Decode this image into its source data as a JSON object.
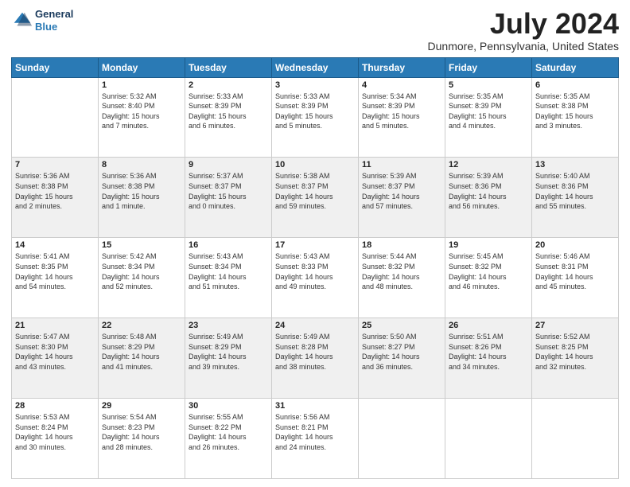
{
  "header": {
    "logo_line1": "General",
    "logo_line2": "Blue",
    "month_year": "July 2024",
    "location": "Dunmore, Pennsylvania, United States"
  },
  "days_of_week": [
    "Sunday",
    "Monday",
    "Tuesday",
    "Wednesday",
    "Thursday",
    "Friday",
    "Saturday"
  ],
  "weeks": [
    [
      {
        "num": "",
        "text": ""
      },
      {
        "num": "1",
        "text": "Sunrise: 5:32 AM\nSunset: 8:40 PM\nDaylight: 15 hours\nand 7 minutes."
      },
      {
        "num": "2",
        "text": "Sunrise: 5:33 AM\nSunset: 8:39 PM\nDaylight: 15 hours\nand 6 minutes."
      },
      {
        "num": "3",
        "text": "Sunrise: 5:33 AM\nSunset: 8:39 PM\nDaylight: 15 hours\nand 5 minutes."
      },
      {
        "num": "4",
        "text": "Sunrise: 5:34 AM\nSunset: 8:39 PM\nDaylight: 15 hours\nand 5 minutes."
      },
      {
        "num": "5",
        "text": "Sunrise: 5:35 AM\nSunset: 8:39 PM\nDaylight: 15 hours\nand 4 minutes."
      },
      {
        "num": "6",
        "text": "Sunrise: 5:35 AM\nSunset: 8:38 PM\nDaylight: 15 hours\nand 3 minutes."
      }
    ],
    [
      {
        "num": "7",
        "text": "Sunrise: 5:36 AM\nSunset: 8:38 PM\nDaylight: 15 hours\nand 2 minutes."
      },
      {
        "num": "8",
        "text": "Sunrise: 5:36 AM\nSunset: 8:38 PM\nDaylight: 15 hours\nand 1 minute."
      },
      {
        "num": "9",
        "text": "Sunrise: 5:37 AM\nSunset: 8:37 PM\nDaylight: 15 hours\nand 0 minutes."
      },
      {
        "num": "10",
        "text": "Sunrise: 5:38 AM\nSunset: 8:37 PM\nDaylight: 14 hours\nand 59 minutes."
      },
      {
        "num": "11",
        "text": "Sunrise: 5:39 AM\nSunset: 8:37 PM\nDaylight: 14 hours\nand 57 minutes."
      },
      {
        "num": "12",
        "text": "Sunrise: 5:39 AM\nSunset: 8:36 PM\nDaylight: 14 hours\nand 56 minutes."
      },
      {
        "num": "13",
        "text": "Sunrise: 5:40 AM\nSunset: 8:36 PM\nDaylight: 14 hours\nand 55 minutes."
      }
    ],
    [
      {
        "num": "14",
        "text": "Sunrise: 5:41 AM\nSunset: 8:35 PM\nDaylight: 14 hours\nand 54 minutes."
      },
      {
        "num": "15",
        "text": "Sunrise: 5:42 AM\nSunset: 8:34 PM\nDaylight: 14 hours\nand 52 minutes."
      },
      {
        "num": "16",
        "text": "Sunrise: 5:43 AM\nSunset: 8:34 PM\nDaylight: 14 hours\nand 51 minutes."
      },
      {
        "num": "17",
        "text": "Sunrise: 5:43 AM\nSunset: 8:33 PM\nDaylight: 14 hours\nand 49 minutes."
      },
      {
        "num": "18",
        "text": "Sunrise: 5:44 AM\nSunset: 8:32 PM\nDaylight: 14 hours\nand 48 minutes."
      },
      {
        "num": "19",
        "text": "Sunrise: 5:45 AM\nSunset: 8:32 PM\nDaylight: 14 hours\nand 46 minutes."
      },
      {
        "num": "20",
        "text": "Sunrise: 5:46 AM\nSunset: 8:31 PM\nDaylight: 14 hours\nand 45 minutes."
      }
    ],
    [
      {
        "num": "21",
        "text": "Sunrise: 5:47 AM\nSunset: 8:30 PM\nDaylight: 14 hours\nand 43 minutes."
      },
      {
        "num": "22",
        "text": "Sunrise: 5:48 AM\nSunset: 8:29 PM\nDaylight: 14 hours\nand 41 minutes."
      },
      {
        "num": "23",
        "text": "Sunrise: 5:49 AM\nSunset: 8:29 PM\nDaylight: 14 hours\nand 39 minutes."
      },
      {
        "num": "24",
        "text": "Sunrise: 5:49 AM\nSunset: 8:28 PM\nDaylight: 14 hours\nand 38 minutes."
      },
      {
        "num": "25",
        "text": "Sunrise: 5:50 AM\nSunset: 8:27 PM\nDaylight: 14 hours\nand 36 minutes."
      },
      {
        "num": "26",
        "text": "Sunrise: 5:51 AM\nSunset: 8:26 PM\nDaylight: 14 hours\nand 34 minutes."
      },
      {
        "num": "27",
        "text": "Sunrise: 5:52 AM\nSunset: 8:25 PM\nDaylight: 14 hours\nand 32 minutes."
      }
    ],
    [
      {
        "num": "28",
        "text": "Sunrise: 5:53 AM\nSunset: 8:24 PM\nDaylight: 14 hours\nand 30 minutes."
      },
      {
        "num": "29",
        "text": "Sunrise: 5:54 AM\nSunset: 8:23 PM\nDaylight: 14 hours\nand 28 minutes."
      },
      {
        "num": "30",
        "text": "Sunrise: 5:55 AM\nSunset: 8:22 PM\nDaylight: 14 hours\nand 26 minutes."
      },
      {
        "num": "31",
        "text": "Sunrise: 5:56 AM\nSunset: 8:21 PM\nDaylight: 14 hours\nand 24 minutes."
      },
      {
        "num": "",
        "text": ""
      },
      {
        "num": "",
        "text": ""
      },
      {
        "num": "",
        "text": ""
      }
    ]
  ]
}
